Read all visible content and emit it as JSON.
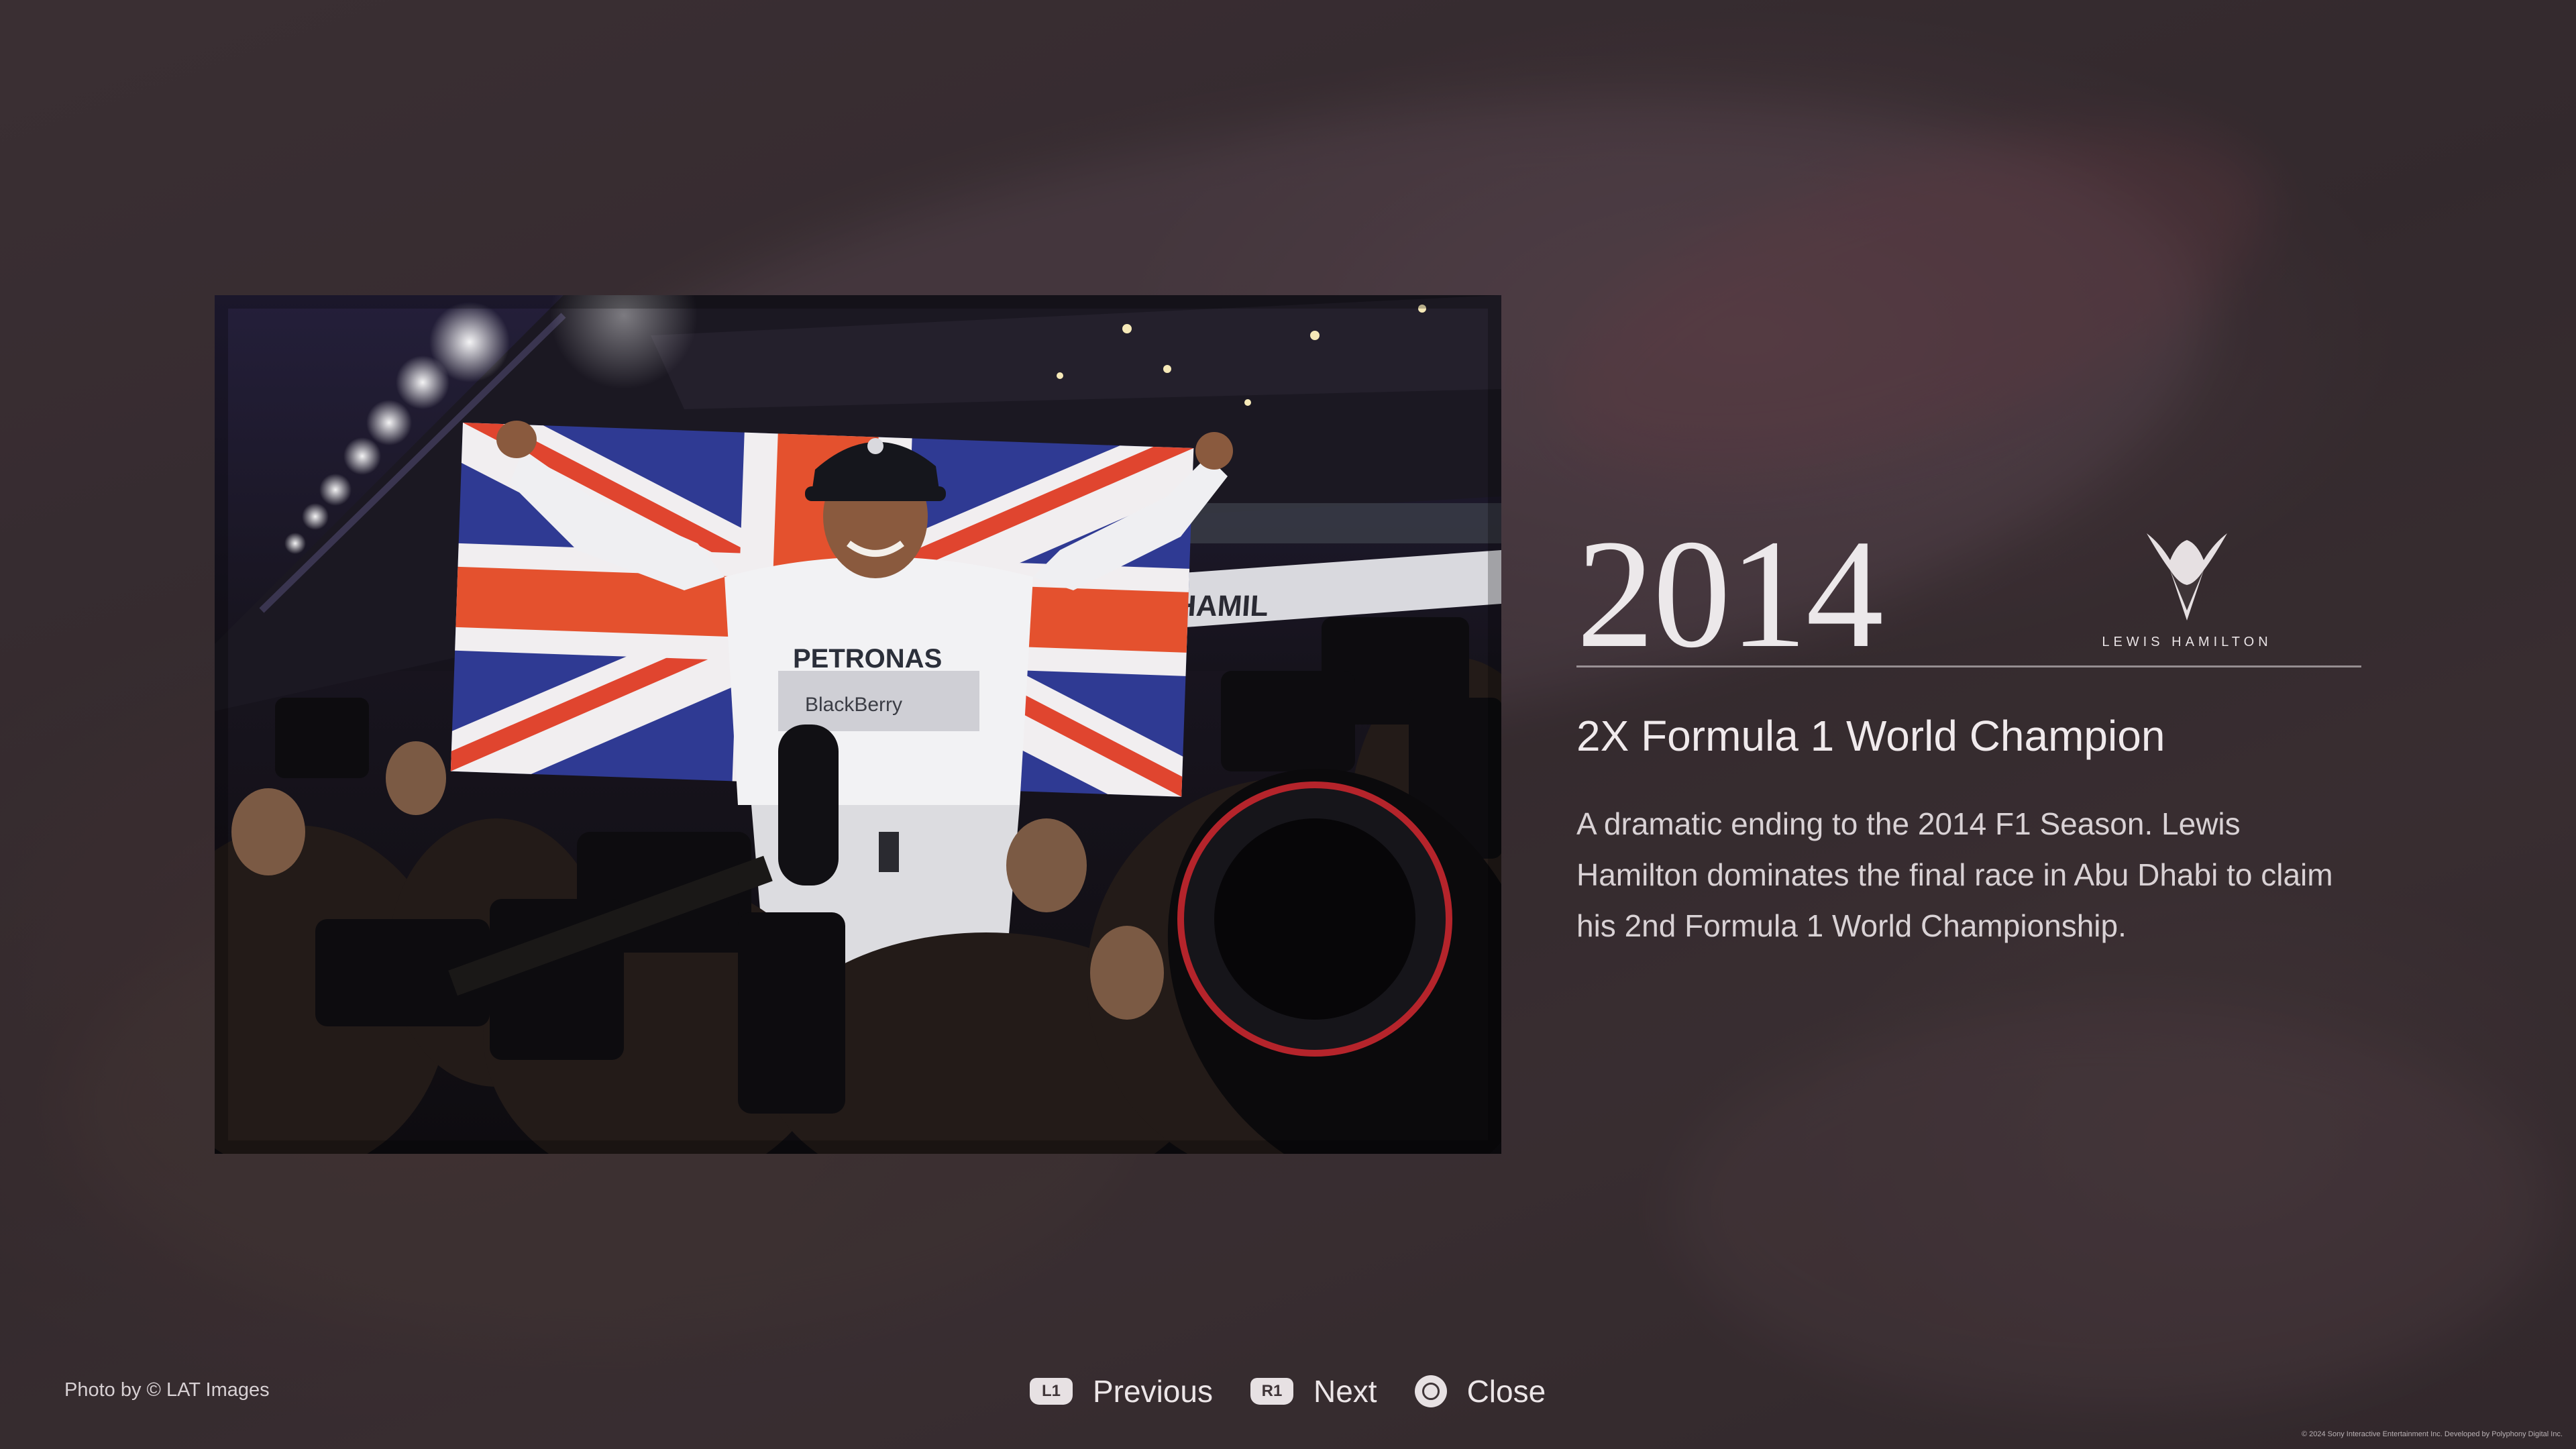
{
  "photo": {
    "alt": "Lewis Hamilton celebrating with the Union Jack flag surrounded by photographers",
    "banner_text": "IS HAMIL",
    "shirt_text": "PETRONAS",
    "shirt_sponsor": "BlackBerry"
  },
  "info": {
    "year": "2014",
    "brand_text": "LEWIS HAMILTON",
    "subtitle": "2X Formula 1 World Champion",
    "description": "A dramatic ending to the 2014 F1 Season. Lewis Hamilton dominates the final race in Abu Dhabi to claim his 2nd Formula 1 World Championship."
  },
  "footer": {
    "credit": "Photo by © LAT Images",
    "previous_badge": "L1",
    "previous_label": "Previous",
    "next_badge": "R1",
    "next_label": "Next",
    "close_label": "Close",
    "copyright": "© 2024 Sony Interactive Entertainment Inc. Developed by Polyphony Digital Inc."
  },
  "colors": {
    "background": "#3f3538",
    "text_primary": "#ece8ea",
    "text_secondary": "#d9d2d5"
  },
  "icons": {
    "brand": "lewis-hamilton-wings-logo",
    "previous": "l1-button-icon",
    "next": "r1-button-icon",
    "close": "circle-button-icon"
  }
}
